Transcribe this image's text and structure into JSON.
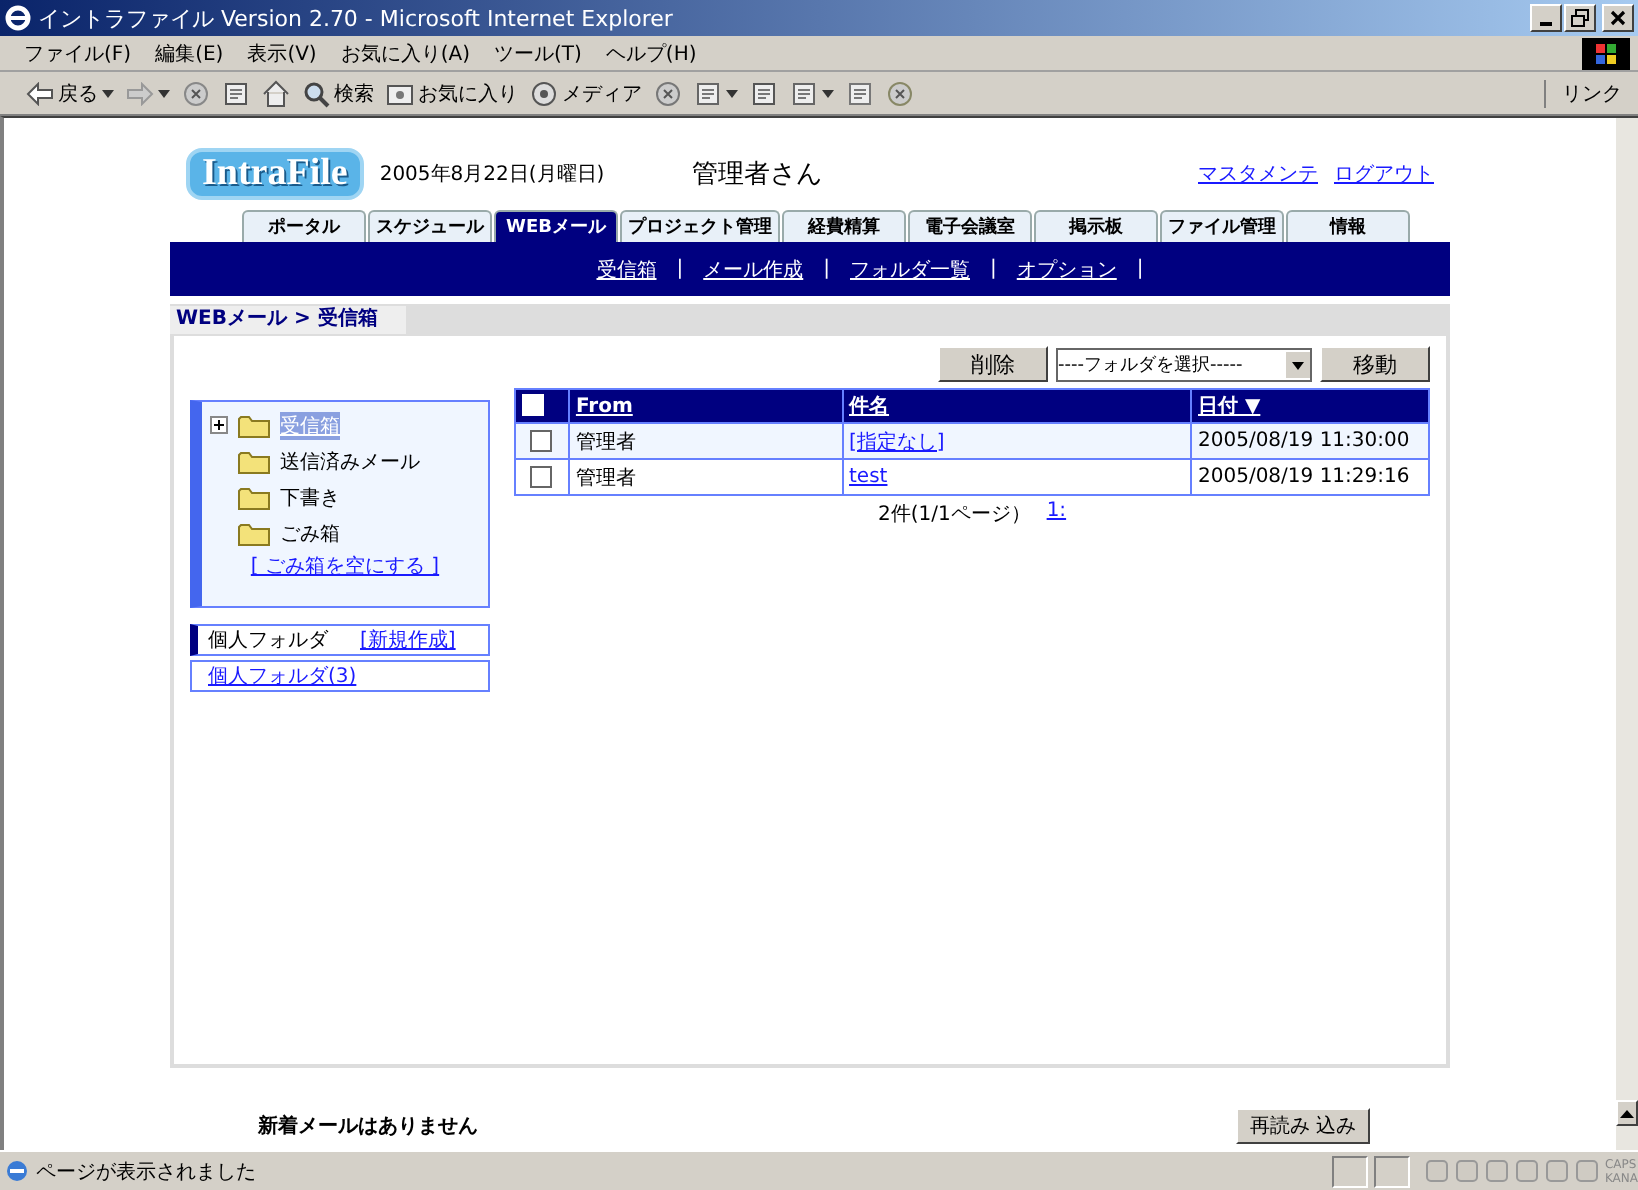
{
  "window": {
    "title": "イントラファイル Version 2.70 - Microsoft Internet Explorer"
  },
  "menu": [
    "ファイル(F)",
    "編集(E)",
    "表示(V)",
    "お気に入り(A)",
    "ツール(T)",
    "ヘルプ(H)"
  ],
  "toolbar": [
    {
      "kind": "back",
      "label": "戻る",
      "dropdown": true
    },
    {
      "kind": "forward",
      "dropdown": true
    },
    {
      "kind": "stop"
    },
    {
      "kind": "refresh"
    },
    {
      "kind": "home"
    },
    {
      "kind": "search",
      "label": "検索"
    },
    {
      "kind": "favorites",
      "label": "お気に入り"
    },
    {
      "kind": "media",
      "label": "メディア"
    },
    {
      "kind": "history"
    },
    {
      "kind": "mail",
      "dropdown": true
    },
    {
      "kind": "print"
    },
    {
      "kind": "edit",
      "dropdown": true
    },
    {
      "kind": "discuss"
    },
    {
      "kind": "messenger"
    }
  ],
  "links_label": "リンク",
  "header": {
    "logo": "IntraFile",
    "date": "2005年8月22日(月曜日)",
    "user": "管理者さん",
    "links": [
      "マスタメンテ",
      "ログアウト"
    ]
  },
  "tabs": [
    {
      "label": "ポータル",
      "selected": false
    },
    {
      "label": "スケジュール",
      "selected": false
    },
    {
      "label": "WEBメール",
      "selected": true
    },
    {
      "label": "プロジェクト管理",
      "selected": false
    },
    {
      "label": "経費精算",
      "selected": false
    },
    {
      "label": "電子会議室",
      "selected": false
    },
    {
      "label": "掲示板",
      "selected": false
    },
    {
      "label": "ファイル管理",
      "selected": false
    },
    {
      "label": "情報",
      "selected": false
    }
  ],
  "subnav": [
    {
      "label": "受信箱",
      "separator": "|"
    },
    {
      "label": "メール作成",
      "separator": "|"
    },
    {
      "label": "フォルダ一覧",
      "separator": "|"
    },
    {
      "label": "オプション",
      "separator": "|"
    }
  ],
  "breadcrumb": "WEBメール > 受信箱",
  "actions": {
    "delete": "削除",
    "folder_select": "----フォルダを選択-----",
    "move": "移動"
  },
  "folders": [
    {
      "name": "受信箱",
      "selected": true,
      "expanded": false
    },
    {
      "name": "送信済みメール",
      "selected": false
    },
    {
      "name": "下書き",
      "selected": false
    },
    {
      "name": "ごみ箱",
      "selected": false
    }
  ],
  "empty_trash": "[ ごみ箱を空にする ]",
  "personal": {
    "label": "個人フォルダ",
    "new_link": "[新規作成]",
    "folder_link": "個人フォルダ(3)"
  },
  "table": {
    "header_checked": false,
    "columns": [
      "From",
      "件名",
      "日付 ▼"
    ],
    "rows": [
      {
        "checked": false,
        "from": "管理者",
        "subject": "[指定なし]",
        "date": "2005/08/19 11:30:00"
      },
      {
        "checked": false,
        "from": "管理者",
        "subject": "test",
        "date": "2005/08/19 11:29:16"
      }
    ]
  },
  "pagination": {
    "summary": "2件(1/1ページ）",
    "page_link": "1:"
  },
  "footer": {
    "notice": "新着メールはありません",
    "reload": "再読み 込み"
  },
  "status_bar": {
    "text": "ページが表示されました",
    "indicators": [
      "CAPS",
      "KANA"
    ]
  }
}
